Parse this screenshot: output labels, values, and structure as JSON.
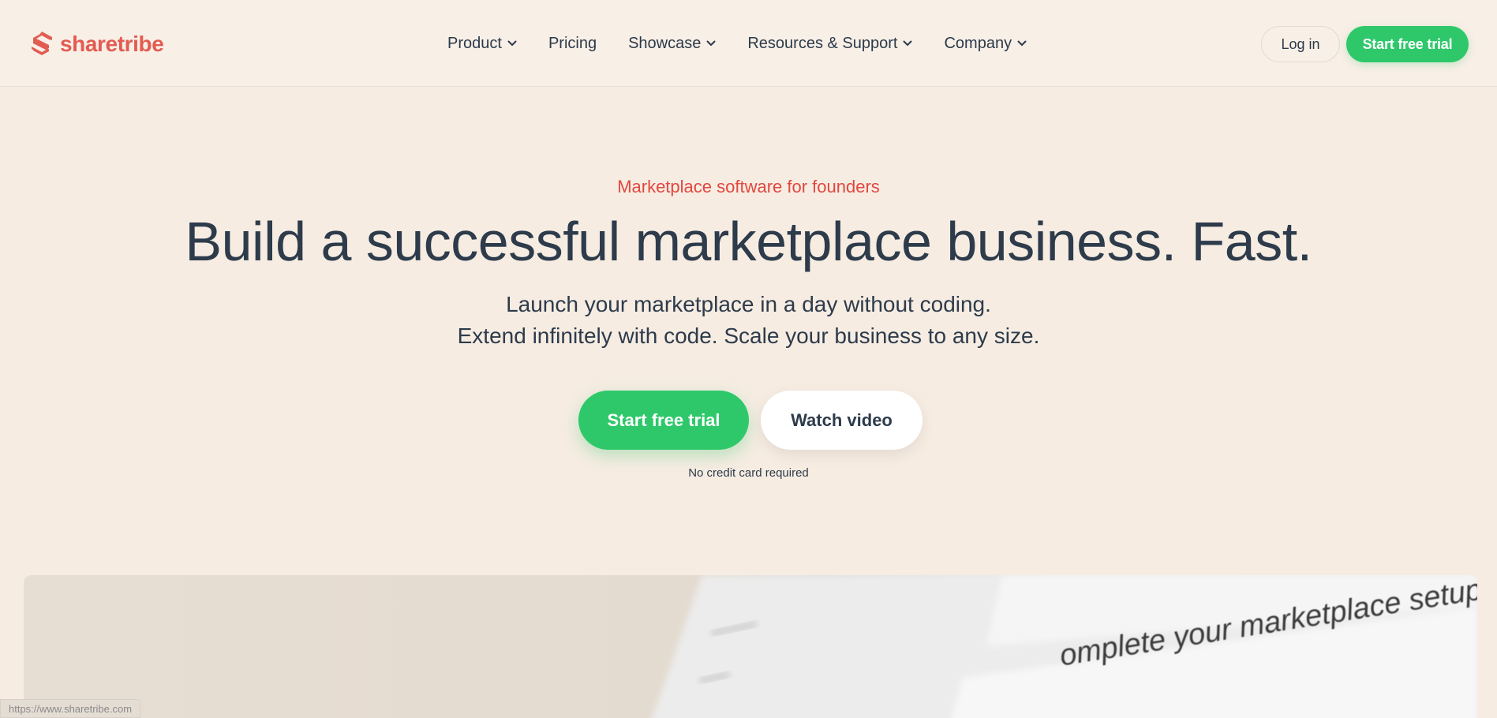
{
  "brand": {
    "name": "sharetribe",
    "color": "#e25c52"
  },
  "nav": {
    "items": [
      {
        "label": "Product",
        "has_dropdown": true
      },
      {
        "label": "Pricing",
        "has_dropdown": false
      },
      {
        "label": "Showcase",
        "has_dropdown": true
      },
      {
        "label": "Resources & Support",
        "has_dropdown": true
      },
      {
        "label": "Company",
        "has_dropdown": true
      }
    ],
    "login_label": "Log in",
    "trial_label": "Start free trial"
  },
  "hero": {
    "eyebrow": "Marketplace software for founders",
    "headline": "Build a successful marketplace business. Fast.",
    "sub_line_1": "Launch your marketplace in a day without coding.",
    "sub_line_2": "Extend infinitely with code. Scale your business to any size.",
    "cta_primary": "Start free trial",
    "cta_secondary": "Watch video",
    "note": "No credit card required"
  },
  "preview": {
    "caption": "omplete your marketplace setup"
  },
  "status_bar": {
    "url": "https://www.sharetribe.com"
  },
  "colors": {
    "background": "#f6ece2",
    "accent_green": "#2ec86b",
    "eyebrow_red": "#e2473f",
    "text_dark": "#2d3b4b"
  }
}
